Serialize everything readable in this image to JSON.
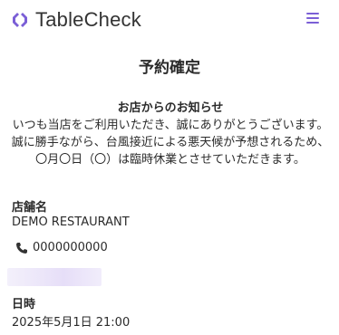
{
  "header": {
    "logo_text": "TableCheck",
    "brand_color": "#7b5fd6",
    "menu_icon": "hamburger-menu-icon"
  },
  "page": {
    "title": "予約確定"
  },
  "notice": {
    "title": "お店からのお知らせ",
    "line1": "いつも当店をご利用いただき、誠にありがとうございます。",
    "line2": "誠に勝手ながら、台風接近による悪天候が予想されるため、〇月〇日（〇）は臨時休業とさせていただきます。"
  },
  "store": {
    "label": "店舗名",
    "name": "DEMO RESTAURANT",
    "phone_icon": "phone-icon",
    "phone": "0000000000"
  },
  "datetime": {
    "label": "日時",
    "value": "2025年5月1日 21:00"
  }
}
